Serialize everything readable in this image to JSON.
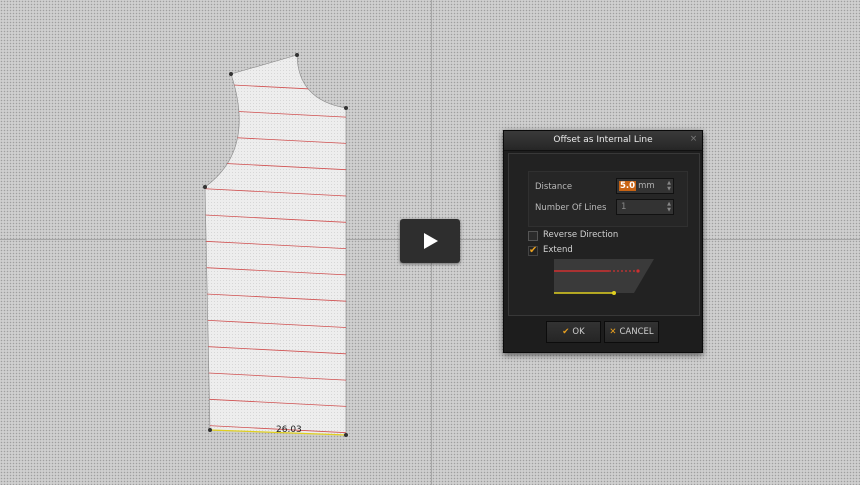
{
  "workspace": {
    "measurement_label": "26.03"
  },
  "video": {
    "play_icon": "play-icon"
  },
  "dialog": {
    "title": "Offset as Internal Line",
    "close_icon": "close-icon",
    "distance": {
      "label": "Distance",
      "value": "5.0",
      "unit": "mm"
    },
    "number_of_lines": {
      "label": "Number Of Lines",
      "value": "1"
    },
    "reverse_direction": {
      "label": "Reverse Direction",
      "checked": false
    },
    "extend": {
      "label": "Extend",
      "checked": true
    },
    "ok_label": "OK",
    "cancel_label": "CANCEL"
  },
  "colors": {
    "accent": "#e8a020",
    "internal_line": "#d05050",
    "seam_highlight": "#e0d020",
    "dialog_bg": "#1d1d1d"
  }
}
